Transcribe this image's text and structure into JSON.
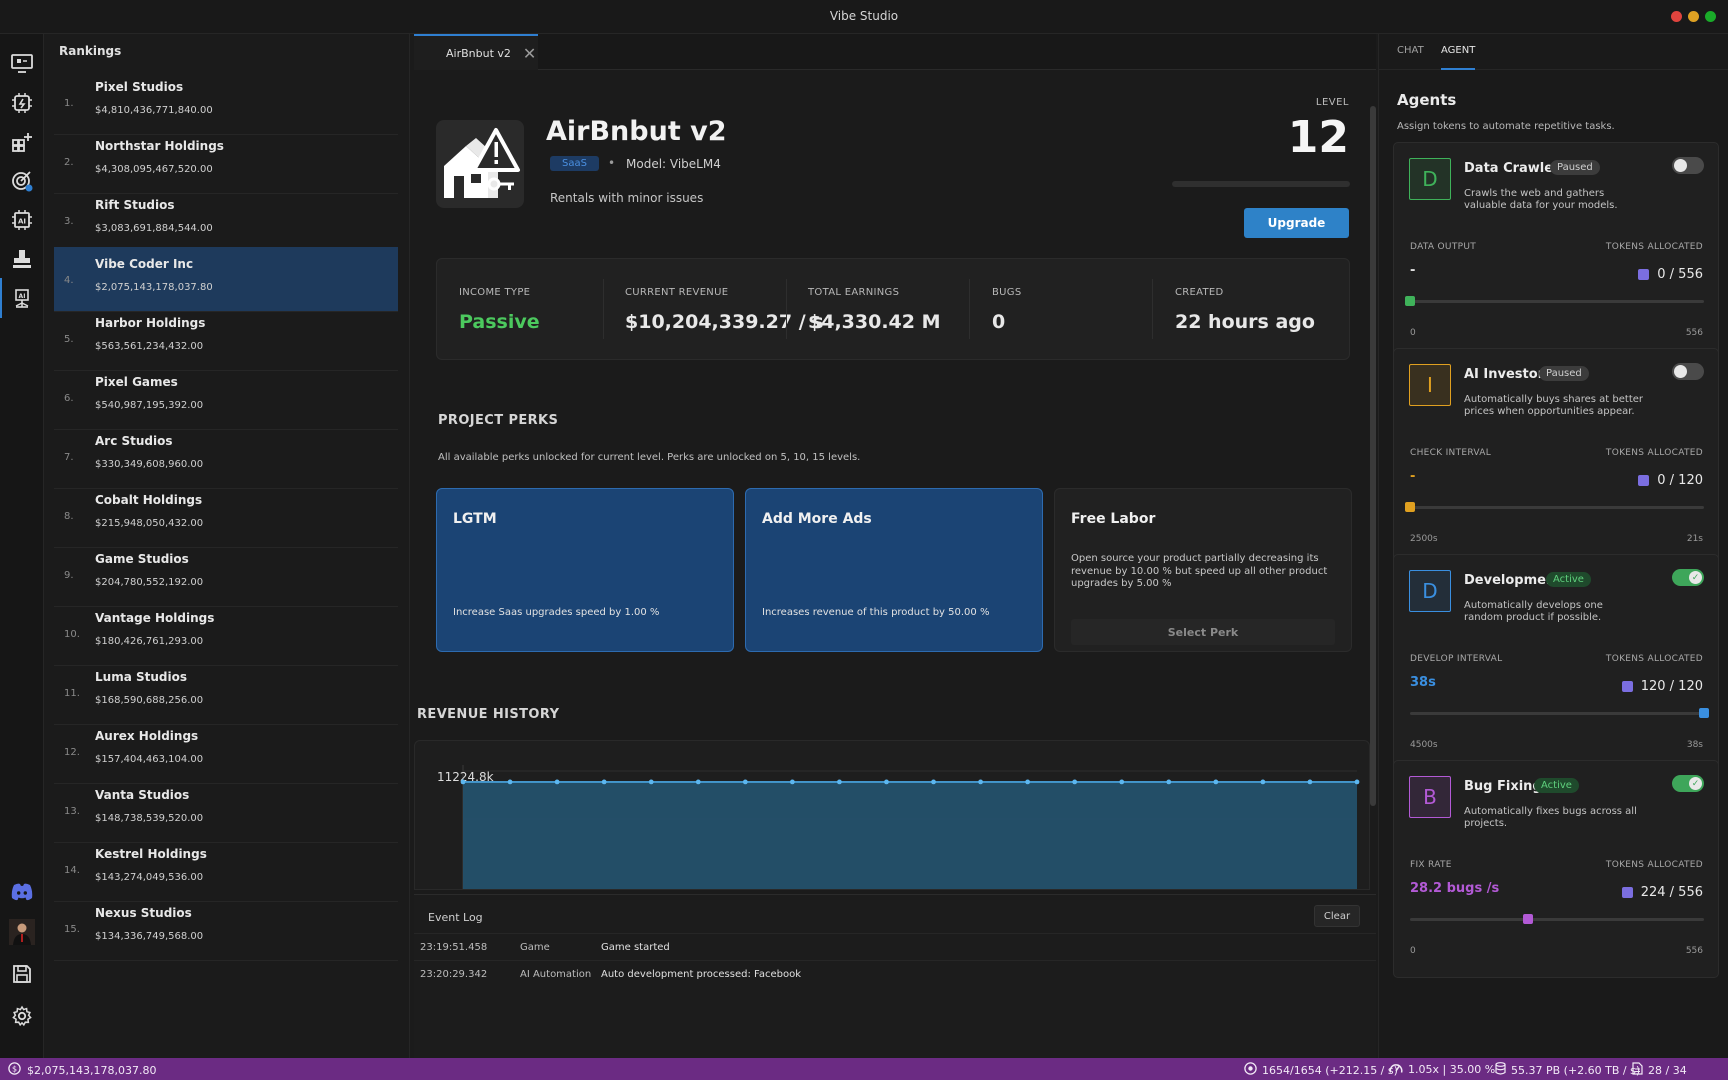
{
  "window": {
    "title": "Vibe Studio"
  },
  "rankings": {
    "title": "Rankings",
    "items": [
      {
        "rank": "1.",
        "name": "Pixel Studios",
        "value": "$4,810,436,771,840.00"
      },
      {
        "rank": "2.",
        "name": "Northstar Holdings",
        "value": "$4,308,095,467,520.00"
      },
      {
        "rank": "3.",
        "name": "Rift Studios",
        "value": "$3,083,691,884,544.00"
      },
      {
        "rank": "4.",
        "name": "Vibe Coder Inc",
        "value": "$2,075,143,178,037.80"
      },
      {
        "rank": "5.",
        "name": "Harbor Holdings",
        "value": "$563,561,234,432.00"
      },
      {
        "rank": "6.",
        "name": "Pixel Games",
        "value": "$540,987,195,392.00"
      },
      {
        "rank": "7.",
        "name": "Arc Studios",
        "value": "$330,349,608,960.00"
      },
      {
        "rank": "8.",
        "name": "Cobalt Holdings",
        "value": "$215,948,050,432.00"
      },
      {
        "rank": "9.",
        "name": "Game Studios",
        "value": "$204,780,552,192.00"
      },
      {
        "rank": "10.",
        "name": "Vantage Holdings",
        "value": "$180,426,761,293.00"
      },
      {
        "rank": "11.",
        "name": "Luma Studios",
        "value": "$168,590,688,256.00"
      },
      {
        "rank": "12.",
        "name": "Aurex Holdings",
        "value": "$157,404,463,104.00"
      },
      {
        "rank": "13.",
        "name": "Vanta Studios",
        "value": "$148,738,539,520.00"
      },
      {
        "rank": "14.",
        "name": "Kestrel Holdings",
        "value": "$143,274,049,536.00"
      },
      {
        "rank": "15.",
        "name": "Nexus Studios",
        "value": "$134,336,749,568.00"
      }
    ]
  },
  "editor_tab": {
    "label": "AirBnbut v2"
  },
  "product": {
    "name": "AirBnbut v2",
    "category": "SaaS",
    "separator": "•",
    "model": "Model: VibeLM4",
    "tagline": "Rentals with minor issues",
    "level_label": "LEVEL",
    "level": "12",
    "level_progress": 0,
    "upgrade_label": "Upgrade"
  },
  "stats": [
    {
      "label": "INCOME TYPE",
      "value": "Passive"
    },
    {
      "label": "CURRENT REVENUE",
      "value": "$10,204,339.27 / s"
    },
    {
      "label": "TOTAL EARNINGS",
      "value": "$4,330.42 M"
    },
    {
      "label": "BUGS",
      "value": "0"
    },
    {
      "label": "CREATED",
      "value": "22 hours ago"
    }
  ],
  "perks": {
    "title": "PROJECT PERKS",
    "note": "All available perks unlocked for current level. Perks are unlocked on 5, 10, 15 levels.",
    "items": [
      {
        "title": "LGTM",
        "desc": "Increase Saas upgrades speed by 1.00 %"
      },
      {
        "title": "Add More Ads",
        "desc": "Increases revenue of this product by 50.00 %"
      },
      {
        "title": "Free Labor",
        "desc": "Open source your product partially decreasing its revenue by 10.00 % but speed up all other product upgrades by 5.00 %",
        "button": "Select Perk"
      }
    ]
  },
  "revenue_history": {
    "title": "REVENUE HISTORY"
  },
  "chart_data": {
    "type": "area",
    "title": "",
    "ymax_label": "11224.8k",
    "ylim": [
      0,
      11224.8
    ],
    "values": [
      10204.3,
      10204.3,
      10204.3,
      10204.3,
      10204.3,
      10204.3,
      10204.3,
      10204.3,
      10204.3,
      10204.3,
      10204.3,
      10204.3,
      10204.3,
      10204.3,
      10204.3,
      10204.3,
      10204.3,
      10204.3,
      10204.3,
      10204.3
    ]
  },
  "event_log": {
    "title": "Event Log",
    "clear_label": "Clear",
    "rows": [
      {
        "time": "23:19:51.458",
        "source": "Game",
        "message": "Game started"
      },
      {
        "time": "23:20:29.342",
        "source": "AI Automation",
        "message": "Auto development processed: Facebook"
      }
    ]
  },
  "right_panel": {
    "tabs": [
      "CHAT",
      "AGENT"
    ],
    "title": "Agents",
    "subtitle": "Assign tokens to automate repetitive tasks.",
    "agents": [
      {
        "letter": "D",
        "name": "Data Crawler",
        "status": "Paused",
        "desc": "Crawls the web and gathers valuable data for your models.",
        "metric_label": "DATA OUTPUT",
        "metric_value": "-",
        "tokens_label": "TOKENS ALLOCATED",
        "tokens": "0 / 556",
        "min": "0",
        "max": "556",
        "level": 0,
        "enabled": false,
        "color": "#3fb25a"
      },
      {
        "letter": "I",
        "name": "AI Investor",
        "status": "Paused",
        "desc": "Automatically buys shares at better prices when opportunities appear.",
        "metric_label": "CHECK INTERVAL",
        "metric_value": "-",
        "tokens_label": "TOKENS ALLOCATED",
        "tokens": "0 / 120",
        "min": "2500s",
        "max": "21s",
        "level": 0,
        "enabled": false,
        "color": "#e0a020"
      },
      {
        "letter": "D",
        "name": "Development",
        "status": "Active",
        "desc": "Automatically develops one random product if possible.",
        "metric_label": "DEVELOP INTERVAL",
        "metric_value": "38s",
        "tokens_label": "TOKENS ALLOCATED",
        "tokens": "120 / 120",
        "min": "4500s",
        "max": "38s",
        "level": 1,
        "enabled": true,
        "color": "#3a8fe0"
      },
      {
        "letter": "B",
        "name": "Bug Fixing",
        "status": "Active",
        "desc": "Automatically fixes bugs across all projects.",
        "metric_label": "FIX RATE",
        "metric_value": "28.2 bugs /s",
        "tokens_label": "TOKENS ALLOCATED",
        "tokens": "224 / 556",
        "min": "0",
        "max": "556",
        "level": 0.403,
        "enabled": true,
        "color": "#b35ad6"
      }
    ]
  },
  "status_bar": {
    "money": "$2,075,143,178,037.80",
    "tokens": "1654/1654 (+212.15 / s)",
    "speed": "1.05x | 35.00 %",
    "storage": "55.37 PB (+2.60 TB / s)",
    "count": "28 / 34"
  }
}
